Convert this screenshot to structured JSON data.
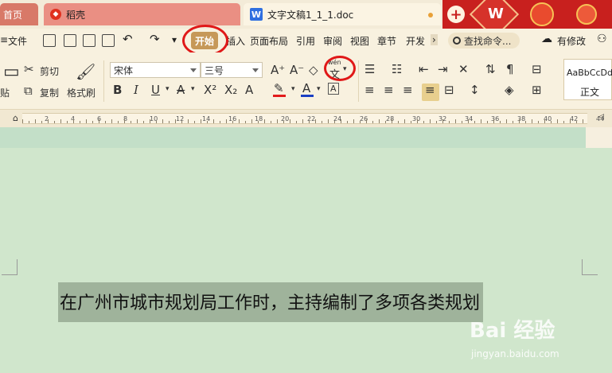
{
  "tabs": {
    "home": "首页",
    "docer": "稻壳",
    "document": "文字文稿1_1_1.doc"
  },
  "menu": {
    "file": "文件",
    "start": "开始",
    "insert": "插入",
    "page_layout": "页面布局",
    "references": "引用",
    "review": "审阅",
    "view": "视图",
    "chapter": "章节",
    "developer": "开发",
    "search": "查找命令...",
    "track_changes": "有修改"
  },
  "ribbon": {
    "cut": "剪切",
    "copy": "复制",
    "format_painter": "格式刷",
    "paste_short": "贴",
    "font_name": "宋体",
    "font_size": "三号",
    "style_sample": "AaBbCcDd",
    "style_name": "正文",
    "phonetic_label": "wén"
  },
  "colors": {
    "font_color": "#1a3fc4",
    "highlight_color": "#e21b1b",
    "annotation": "#e01818"
  },
  "ruler": {
    "numbers": [
      "2",
      "4",
      "6",
      "8",
      "10",
      "12",
      "14",
      "16",
      "18",
      "20",
      "22",
      "24",
      "26",
      "28",
      "30",
      "32",
      "34",
      "36",
      "38",
      "40",
      "42",
      "44"
    ]
  },
  "document": {
    "selected_text": "在广州市城市规划局工作时，主持编制了多项各类规划"
  },
  "watermark": {
    "brand": "Bai 经验",
    "url": "jingyan.baidu.com"
  }
}
